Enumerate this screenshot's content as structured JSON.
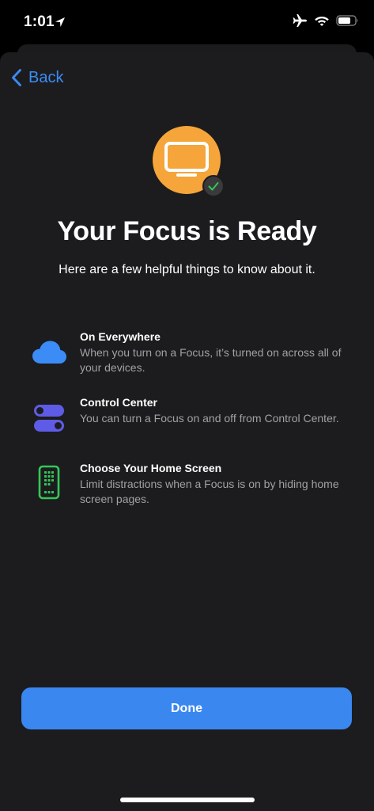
{
  "status_bar": {
    "time": "1:01"
  },
  "nav": {
    "back_label": "Back"
  },
  "hero": {
    "icon": "tv-icon",
    "badge_icon": "checkmark-icon",
    "title": "Your Focus is Ready",
    "subtitle": "Here are a few helpful things to know about it."
  },
  "features": [
    {
      "icon": "cloud-icon",
      "title": "On Everywhere",
      "description": "When you turn on a Focus, it’s turned on across all of your devices."
    },
    {
      "icon": "toggles-icon",
      "title": "Control Center",
      "description": "You can turn a Focus on and off from Control Center."
    },
    {
      "icon": "phone-home-screen-icon",
      "title": "Choose Your Home Screen",
      "description": "Limit distractions when a Focus is on by hiding home screen pages."
    }
  ],
  "actions": {
    "done_label": "Done"
  },
  "colors": {
    "accent": "#3a87f0",
    "hero_bg": "#f5a53a",
    "cloud": "#3b8cf6",
    "toggles": "#5e5ce6",
    "phone": "#34c759",
    "sheet_bg": "#1c1c1e",
    "secondary_text": "#a1a1a6"
  }
}
